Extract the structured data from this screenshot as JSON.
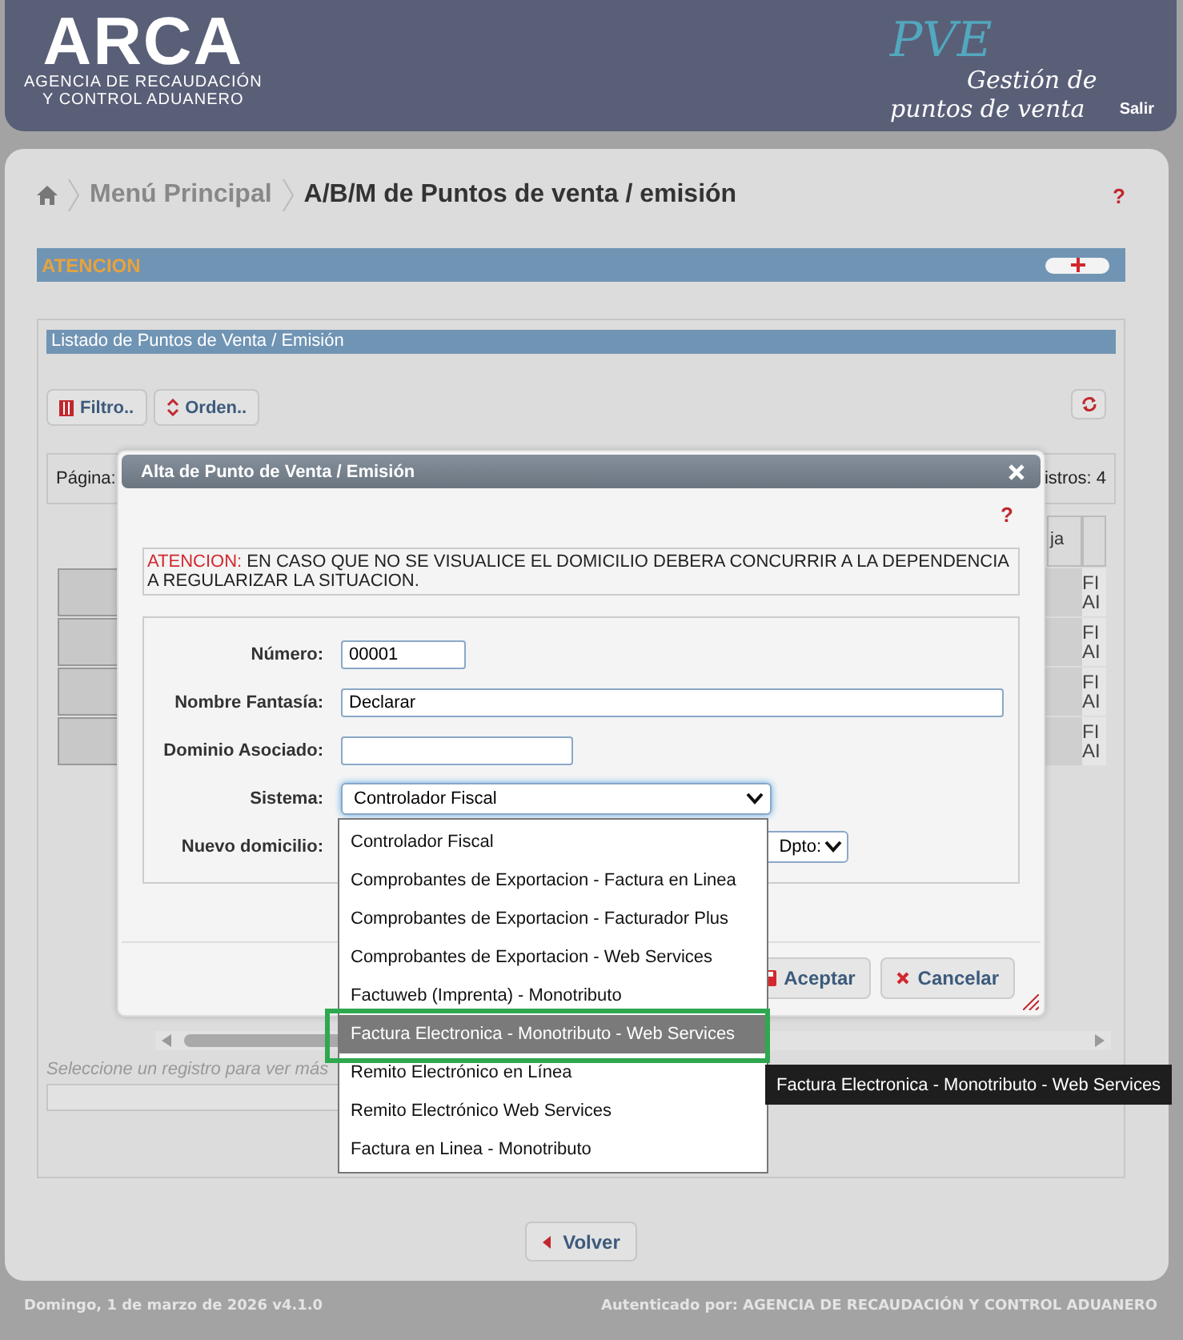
{
  "header": {
    "logo": {
      "title": "ARCA",
      "subtitle_lines": [
        "AGENCIA DE RECAUDACIÓN",
        "Y CONTROL ADUANERO"
      ]
    },
    "app_logo": {
      "title": "PVE",
      "lines": [
        "Gestión de",
        "puntos de venta"
      ]
    },
    "logout": "Salir"
  },
  "breadcrumb": {
    "items": [
      "Menú Principal",
      "A/B/M de Puntos de venta / emisión"
    ],
    "help": "?"
  },
  "attention_panel": {
    "title": "ATENCION",
    "expanded": false
  },
  "list_panel": {
    "title": "Listado de Puntos de Venta / Emisión",
    "toolbar": [
      "Filtro..",
      "Orden.."
    ],
    "pager": {
      "label": "Página:",
      "records": "istros: 4"
    },
    "table": {
      "column_partial": "ja",
      "rows": [
        [
          "FI",
          "AI"
        ],
        [
          "FI",
          "AI"
        ],
        [
          "FI",
          "AI"
        ],
        [
          "FI",
          "AI"
        ]
      ]
    },
    "hint": "Seleccione un registro para ver más"
  },
  "back_button": "Volver",
  "footer": {
    "left": "Domingo, 1 de marzo de 2026 v4.1.0",
    "right": "Autenticado por: AGENCIA DE RECAUDACIÓN Y CONTROL ADUANERO"
  },
  "dialog": {
    "title": "Alta de Punto de Venta / Emisión",
    "help": "?",
    "warning": {
      "label": "ATENCION:",
      "text": "EN CASO QUE NO SE VISUALICE EL DOMICILIO DEBERA CONCURRIR A LA DEPENDENCIA A REGULARIZAR LA SITUACION."
    },
    "fields": [
      {
        "label": "Número:",
        "kind": "text",
        "value": "00001"
      },
      {
        "label": "Nombre Fantasía:",
        "kind": "text",
        "value": "Declarar"
      },
      {
        "label": "Dominio Asociado:",
        "kind": "text"
      },
      {
        "label": "Sistema:",
        "kind": "select",
        "value": "Controlador Fiscal",
        "focused": true
      },
      {
        "label": "Nuevo domicilio:",
        "kind": "address",
        "unit_label": "Dpto:"
      }
    ],
    "buttons": [
      {
        "label": "Aceptar",
        "kind": "save"
      },
      {
        "label": "Cancelar",
        "kind": "cancel"
      }
    ]
  },
  "dropdown": {
    "options": [
      {
        "label": "Controlador Fiscal",
        "selected": false
      },
      {
        "label": "Comprobantes de Exportacion - Factura en Linea",
        "selected": false
      },
      {
        "label": "Comprobantes de Exportacion - Facturador Plus",
        "selected": false
      },
      {
        "label": "Comprobantes de Exportacion - Web Services",
        "selected": false
      },
      {
        "label": "Factuweb (Imprenta) - Monotributo",
        "selected": false
      },
      {
        "label": "Factura Electronica - Monotributo - Web Services",
        "selected": true,
        "highlighted": true
      },
      {
        "label": "Remito Electrónico en Línea",
        "selected": false
      },
      {
        "label": "Remito Electrónico Web Services",
        "selected": false
      },
      {
        "label": "Factura en Linea - Monotributo",
        "selected": false
      }
    ]
  },
  "tooltip": "Factura Electronica - Monotributo - Web Services"
}
